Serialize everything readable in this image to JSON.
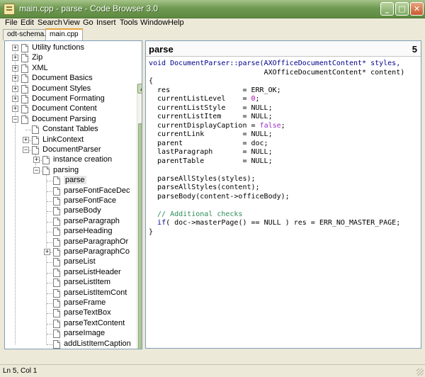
{
  "window": {
    "title": "main.cpp - parse - Code Browser 3.0"
  },
  "window_buttons": {
    "minimize": "_",
    "maximize": "□",
    "close": "✕"
  },
  "menu": [
    "File",
    "Edit",
    "Search",
    "View",
    "Go",
    "Insert",
    "Tools",
    "Window",
    "Help"
  ],
  "tabs": [
    {
      "label": "odt-schema.h",
      "active": false
    },
    {
      "label": "main.cpp",
      "active": true
    }
  ],
  "tree": {
    "items": [
      {
        "label": "Utility functions",
        "expander": "+"
      },
      {
        "label": "Zip",
        "expander": "+"
      },
      {
        "label": "XML",
        "expander": "+"
      },
      {
        "label": "Document Basics",
        "expander": "+"
      },
      {
        "label": "Document Styles",
        "expander": "+"
      },
      {
        "label": "Document Formating",
        "expander": "+"
      },
      {
        "label": "Document Content",
        "expander": "+"
      },
      {
        "label": "Document Parsing",
        "expander": "−"
      },
      {
        "label": "Constant Tables",
        "expander": ""
      },
      {
        "label": "LinkContext",
        "expander": "+"
      },
      {
        "label": "DocumentParser",
        "expander": "−"
      },
      {
        "label": "instance creation",
        "expander": "+"
      },
      {
        "label": "parsing",
        "expander": "−"
      },
      {
        "label": "parse",
        "expander": ""
      },
      {
        "label": "parseFontFaceDec",
        "expander": ""
      },
      {
        "label": "parseFontFace",
        "expander": ""
      },
      {
        "label": "parseBody",
        "expander": ""
      },
      {
        "label": "parseParagraph",
        "expander": ""
      },
      {
        "label": "parseHeading",
        "expander": ""
      },
      {
        "label": "parseParagraphOr",
        "expander": ""
      },
      {
        "label": "parseParagraphCo",
        "expander": "+"
      },
      {
        "label": "parseList",
        "expander": ""
      },
      {
        "label": "parseListHeader",
        "expander": ""
      },
      {
        "label": "parseListItem",
        "expander": ""
      },
      {
        "label": "parseListItemCont",
        "expander": ""
      },
      {
        "label": "parseFrame",
        "expander": ""
      },
      {
        "label": "parseTextBox",
        "expander": ""
      },
      {
        "label": "parseTextContent",
        "expander": ""
      },
      {
        "label": "parseImage",
        "expander": ""
      },
      {
        "label": "addListItemCaption",
        "expander": ""
      }
    ],
    "selected": "parse",
    "scroll_arrows": {
      "up": "▲",
      "down": "▼",
      "left": "◀",
      "right": "▶"
    }
  },
  "code_header": {
    "name": "parse",
    "line": "5"
  },
  "code_lines": [
    [
      [
        "void DocumentParser::parse(AXOfficeDocumentContent* styles,",
        "kw"
      ]
    ],
    [
      [
        "                           AXOfficeDocumentContent* content)",
        ""
      ]
    ],
    [
      [
        "{",
        ""
      ]
    ],
    [
      [
        "  res                 = ERR_OK;",
        ""
      ]
    ],
    [
      [
        "  currentListLevel    = ",
        ""
      ],
      [
        "0",
        "num"
      ],
      [
        ";",
        ""
      ]
    ],
    [
      [
        "  currentListStyle    = NULL;",
        ""
      ]
    ],
    [
      [
        "  currentListItem     = NULL;",
        ""
      ]
    ],
    [
      [
        "  currentDisplayCaption = ",
        ""
      ],
      [
        "false",
        "lit"
      ],
      [
        ";",
        ""
      ]
    ],
    [
      [
        "  currentLink         = NULL;",
        ""
      ]
    ],
    [
      [
        "  parent              = doc;",
        ""
      ]
    ],
    [
      [
        "  lastParagraph       = NULL;",
        ""
      ]
    ],
    [
      [
        "  parentTable         = NULL;",
        ""
      ]
    ],
    [
      [
        "",
        ""
      ]
    ],
    [
      [
        "  parseAllStyles(styles);",
        ""
      ]
    ],
    [
      [
        "  parseAllStyles(content);",
        ""
      ]
    ],
    [
      [
        "  parseBody(content->officeBody);",
        ""
      ]
    ],
    [
      [
        "",
        ""
      ]
    ],
    [
      [
        "  // Additional checks",
        "cmt"
      ]
    ],
    [
      [
        "  ",
        ""
      ],
      [
        "if",
        "kw"
      ],
      [
        "( doc->masterPage() == NULL ) res = ERR_NO_MASTER_PAGE;",
        ""
      ]
    ],
    [
      [
        "}",
        ""
      ]
    ]
  ],
  "status": {
    "text": "Ln 5, Col 1"
  }
}
